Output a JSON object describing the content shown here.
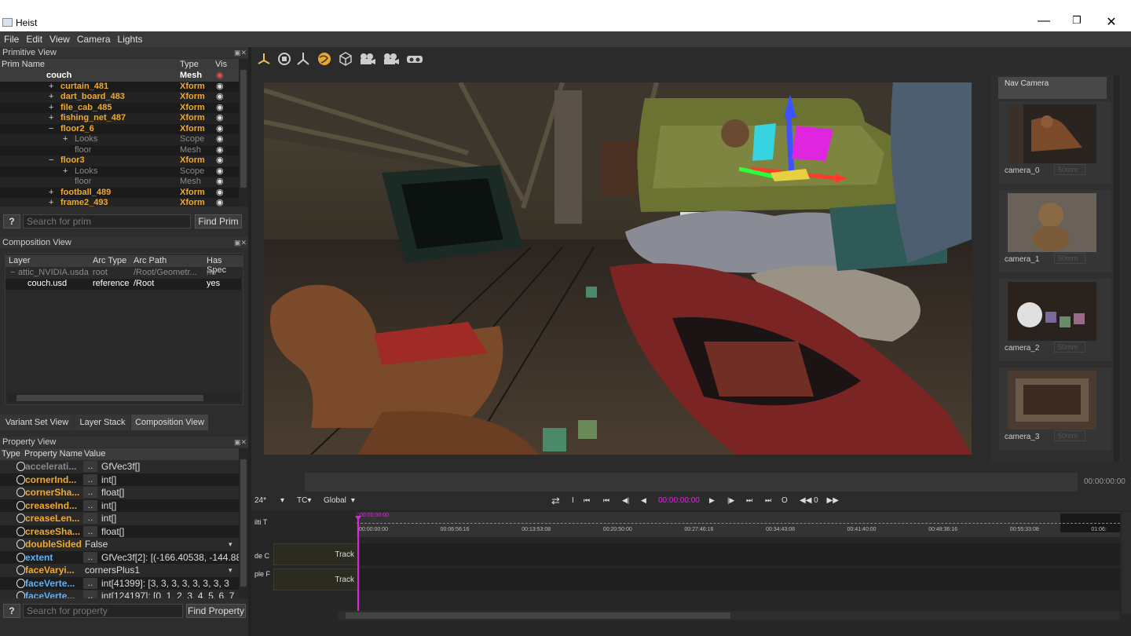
{
  "app": {
    "title": "Heist"
  },
  "menu": [
    "File",
    "Edit",
    "View",
    "Camera",
    "Lights"
  ],
  "primitive_view": {
    "title": "Primitive View",
    "columns": [
      "Prim Name",
      "Type",
      "Vis"
    ],
    "rows": [
      {
        "name": "couch",
        "type": "Mesh",
        "expander": "",
        "style": "selected"
      },
      {
        "name": "curtain_481",
        "type": "Xform",
        "expander": "+",
        "style": "gold"
      },
      {
        "name": "dart_board_483",
        "type": "Xform",
        "expander": "+",
        "style": "gold"
      },
      {
        "name": "file_cab_485",
        "type": "Xform",
        "expander": "+",
        "style": "gold"
      },
      {
        "name": "fishing_net_487",
        "type": "Xform",
        "expander": "+",
        "style": "gold"
      },
      {
        "name": "floor2_6",
        "type": "Xform",
        "expander": "−",
        "style": "gold"
      },
      {
        "name": "Looks",
        "type": "Scope",
        "expander": "+",
        "style": "grey"
      },
      {
        "name": "floor",
        "type": "Mesh",
        "expander": "",
        "style": "grey"
      },
      {
        "name": "floor3",
        "type": "Xform",
        "expander": "−",
        "style": "gold"
      },
      {
        "name": "Looks",
        "type": "Scope",
        "expander": "+",
        "style": "grey"
      },
      {
        "name": "floor",
        "type": "Mesh",
        "expander": "",
        "style": "grey"
      },
      {
        "name": "football_489",
        "type": "Xform",
        "expander": "+",
        "style": "gold"
      },
      {
        "name": "frame2_493",
        "type": "Xform",
        "expander": "+",
        "style": "gold"
      }
    ],
    "search_placeholder": "Search for prim",
    "help_label": "?",
    "find_label": "Find Prim"
  },
  "composition_view": {
    "title": "Composition View",
    "columns": [
      "Layer",
      "Arc Type",
      "Arc Path",
      "Has Spec"
    ],
    "rows": [
      {
        "layer": "attic_NVIDIA.usda",
        "arc_type": "root",
        "arc_path": "/Root/Geometr...",
        "has_spec": "no",
        "style": "grey"
      },
      {
        "layer": "couch.usd",
        "arc_type": "reference",
        "arc_path": "/Root",
        "has_spec": "yes",
        "style": "normal"
      }
    ]
  },
  "tabs": [
    "Variant Set View",
    "Layer Stack",
    "Composition View"
  ],
  "property_view": {
    "title": "Property View",
    "columns": [
      "Type",
      "Property Name",
      "Value"
    ],
    "rows": [
      {
        "name": "accelerati...",
        "value": "GfVec3f[]",
        "style": "grey",
        "btn": ".."
      },
      {
        "name": "cornerInd...",
        "value": "int[]",
        "style": "orange",
        "btn": ".."
      },
      {
        "name": "cornerSha...",
        "value": "float[]",
        "style": "orange",
        "btn": ".."
      },
      {
        "name": "creaseInd...",
        "value": "int[]",
        "style": "orange",
        "btn": ".."
      },
      {
        "name": "creaseLen...",
        "value": "int[]",
        "style": "orange",
        "btn": ".."
      },
      {
        "name": "creaseSha...",
        "value": "float[]",
        "style": "orange",
        "btn": ".."
      },
      {
        "name": "doubleSided",
        "value": "False",
        "style": "orange",
        "btn": ""
      },
      {
        "name": "extent",
        "value": "GfVec3f[2]: [(-166.40538, -144.888",
        "style": "blue",
        "btn": ".."
      },
      {
        "name": "faceVaryi...",
        "value": "cornersPlus1",
        "style": "orange",
        "btn": ""
      },
      {
        "name": "faceVerte...",
        "value": "int[41399]: [3, 3, 3, 3, 3, 3, 3, 3",
        "style": "blue",
        "btn": ".."
      },
      {
        "name": "faceVerte...",
        "value": "int[124197]: [0, 1, 2, 3, 4, 5, 6, 7",
        "style": "blue",
        "btn": ".."
      }
    ],
    "search_placeholder": "Search for property",
    "help_label": "?",
    "find_label": "Find Property"
  },
  "nav_camera": {
    "title": "Nav Camera",
    "cameras": [
      {
        "label": "camera_0",
        "mm": "50mm"
      },
      {
        "label": "camera_1",
        "mm": "50mm"
      },
      {
        "label": "camera_2",
        "mm": "50mm"
      },
      {
        "label": "camera_3",
        "mm": "50mm"
      }
    ]
  },
  "playback": {
    "fps": "24*",
    "tc": "TC",
    "space": "Global",
    "current_time": "00:00:00:00",
    "end_time": "00:00:00:00",
    "loop_label": "I",
    "speed": "0",
    "o_label": "O"
  },
  "timeline": {
    "playhead_label": "00:00:00:00",
    "ticks": [
      "00:00:00:00",
      "00:06:56:16",
      "00:13:53:08",
      "00:20:50:00",
      "00:27:46:16",
      "00:34:43:08",
      "00:41:40:00",
      "00:48:36:16",
      "00:55:33:08",
      "01:06:"
    ],
    "side_labels": [
      "ilti T",
      "de C",
      "ple F"
    ],
    "tracks": [
      {
        "label": "Track"
      },
      {
        "label": "Track"
      }
    ]
  },
  "colors": {
    "accent": "#f1a92c",
    "magenta": "#e025e0",
    "blue_prop": "#5ab3ff"
  }
}
